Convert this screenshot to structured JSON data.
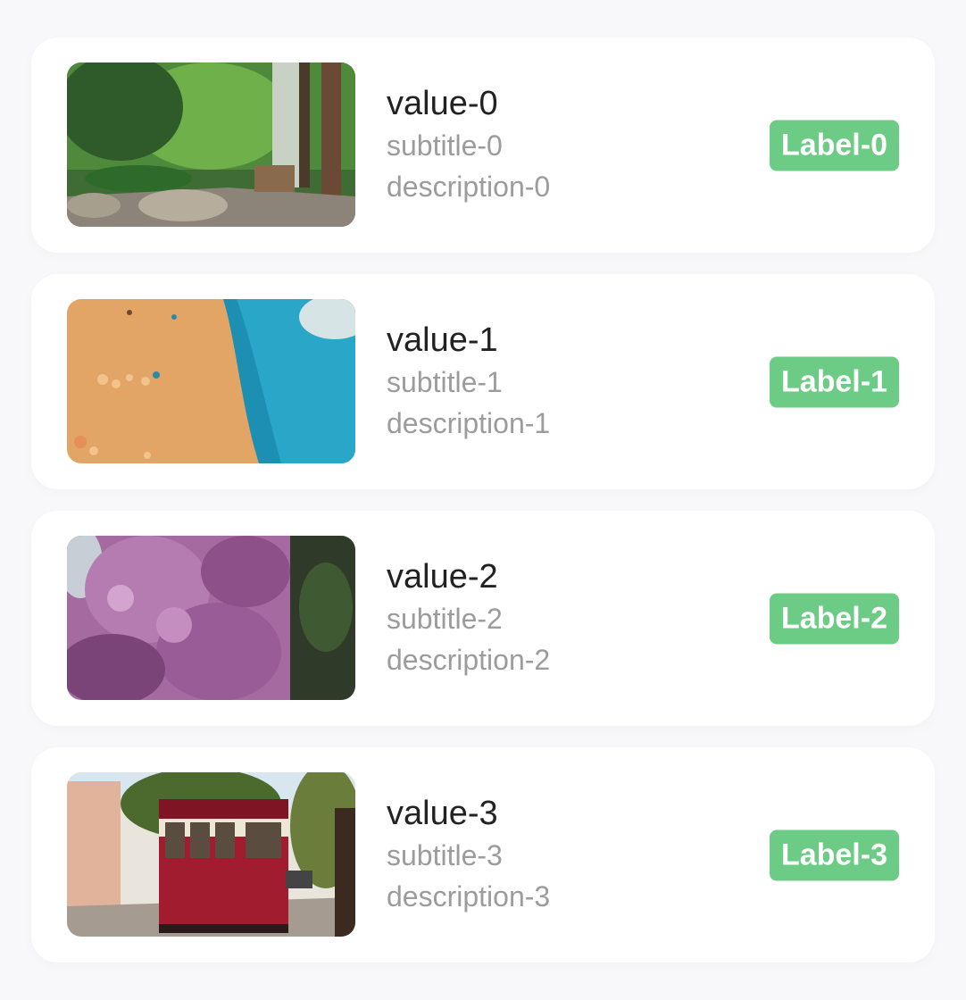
{
  "items": [
    {
      "title": "value-0",
      "subtitle": "subtitle-0",
      "description": "description-0",
      "badge": "Label-0",
      "image": "garden-path-photo"
    },
    {
      "title": "value-1",
      "subtitle": "subtitle-1",
      "description": "description-1",
      "badge": "Label-1",
      "image": "abstract-paint-photo"
    },
    {
      "title": "value-2",
      "subtitle": "subtitle-2",
      "description": "description-2",
      "badge": "Label-2",
      "image": "lilac-flowers-photo"
    },
    {
      "title": "value-3",
      "subtitle": "subtitle-3",
      "description": "description-3",
      "badge": "Label-3",
      "image": "tram-street-photo"
    }
  ],
  "colors": {
    "badge": "#6ccb85",
    "title": "#222222",
    "secondary": "#9c9c9c",
    "card": "#ffffff",
    "background": "#f8f7fa"
  }
}
